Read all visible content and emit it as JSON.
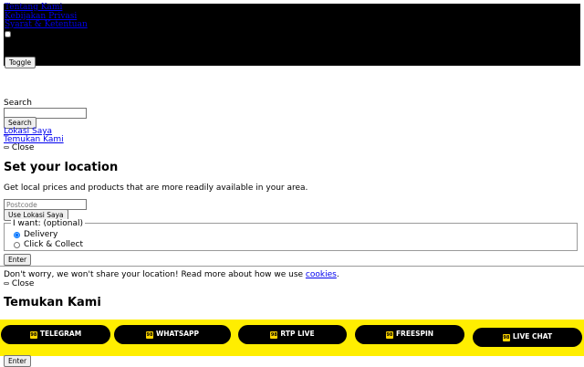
{
  "top_menu": {
    "links": [
      "Tentang Kami",
      "Kebijakan Privasi",
      "Syarat & Ketentuan"
    ],
    "toggle_label": "Toggle"
  },
  "search": {
    "label": "Search",
    "input_value": "",
    "button_label": "Search"
  },
  "nav_links": {
    "my_location": "Lokasi Saya",
    "find_us": "Temukan Kami"
  },
  "location_modal": {
    "close_label": "Close",
    "title": "Set your location",
    "description": "Get local prices and products that are more readily available in your area.",
    "postcode_placeholder": "Postcode",
    "use_location_button": "Use Lokasi Saya",
    "want_legend": "I want: (optional)",
    "options": [
      {
        "label": "Delivery",
        "selected": true
      },
      {
        "label": "Click & Collect",
        "selected": false
      }
    ],
    "enter_button": "Enter",
    "privacy_text_before": "Don't worry, we won't share your location! Read more about how we use ",
    "privacy_link": "cookies",
    "privacy_text_after": "."
  },
  "find_modal": {
    "close_label": "Close",
    "title": "Temukan Kami",
    "enter_button": "Enter"
  },
  "floating_bar": {
    "background_color": "#ffee00",
    "icon_text": "98",
    "buttons": [
      "TELEGRAM",
      "WHATSAPP",
      "RTP LIVE",
      "FREESPIN",
      "LIVE CHAT"
    ]
  }
}
